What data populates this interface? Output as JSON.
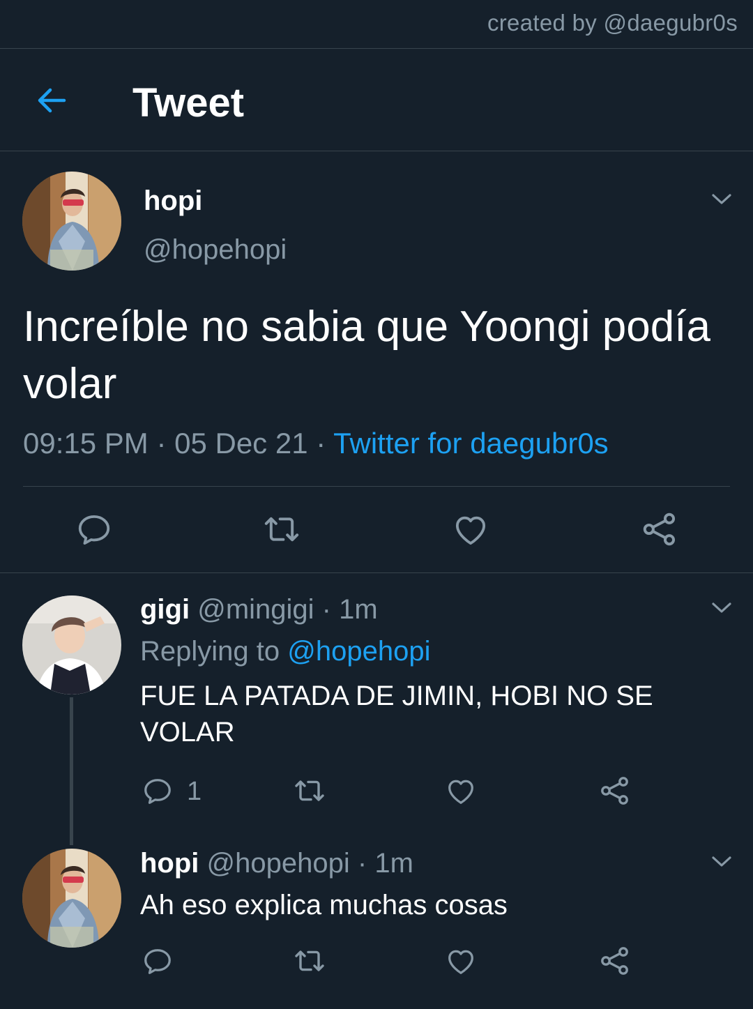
{
  "credit": "created by @daegubr0s",
  "header": {
    "title": "Tweet"
  },
  "tweet": {
    "name": "hopi",
    "handle": "@hopehopi",
    "text": "Increíble no sabia que Yoongi podía volar",
    "time": "09:15 PM",
    "date": "05 Dec 21",
    "source": "Twitter for daegubr0s",
    "dot": " · "
  },
  "replies": [
    {
      "name": "gigi",
      "handle": "@mingigi",
      "age": "· 1m",
      "replying_label": "Replying to",
      "replying_to": "@hopehopi",
      "text": "FUE LA PATADA DE JIMIN, HOBI NO SE VOLAR",
      "reply_count": "1"
    },
    {
      "name": "hopi",
      "handle": "@hopehopi",
      "age": "· 1m",
      "text": "Ah eso explica muchas cosas"
    }
  ],
  "icons": {
    "back": "arrow-left-icon",
    "chevron": "chevron-down-icon",
    "reply": "comment-icon",
    "retweet": "retweet-icon",
    "like": "heart-icon",
    "share": "share-icon"
  },
  "colors": {
    "background": "#15202b",
    "accent": "#1da1f2",
    "muted": "#8899a6",
    "divider": "#38444d"
  }
}
